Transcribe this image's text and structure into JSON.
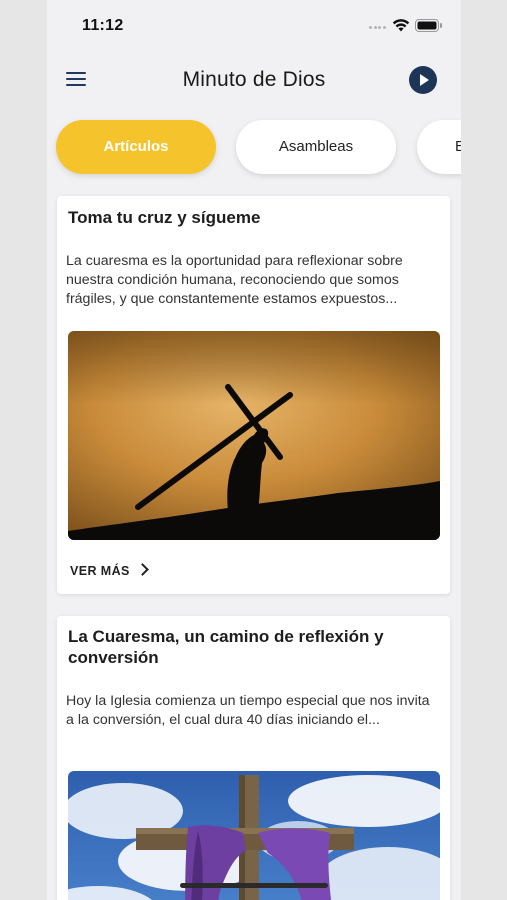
{
  "status_bar": {
    "time": "11:12"
  },
  "header": {
    "title": "Minuto de Dios",
    "menu_icon": "hamburger-menu-icon",
    "play_icon": "play-circle-icon"
  },
  "tabs": [
    {
      "label": "Artículos",
      "active": true
    },
    {
      "label": "Asambleas",
      "active": false
    },
    {
      "label": "E",
      "active": false
    }
  ],
  "articles": [
    {
      "title": "Toma tu cruz y sígueme",
      "excerpt": "La cuaresma es la oportunidad para reflexionar sobre nuestra condición humana, reconociendo que somos frágiles, y que constantemente estamos expuestos...",
      "image": "silhouette-carrying-cross-sunset",
      "read_more_label": "VER MÁS"
    },
    {
      "title": "La Cuaresma, un camino de reflexión y conversión",
      "excerpt": "Hoy la Iglesia comienza un tiempo especial que nos invita a la conversión, el cual dura 40 días iniciando el...",
      "image": "wooden-cross-purple-cloth-sky"
    }
  ],
  "colors": {
    "accent_yellow": "#f5c32c",
    "navy": "#1d3557",
    "background": "#f1f1f3"
  }
}
